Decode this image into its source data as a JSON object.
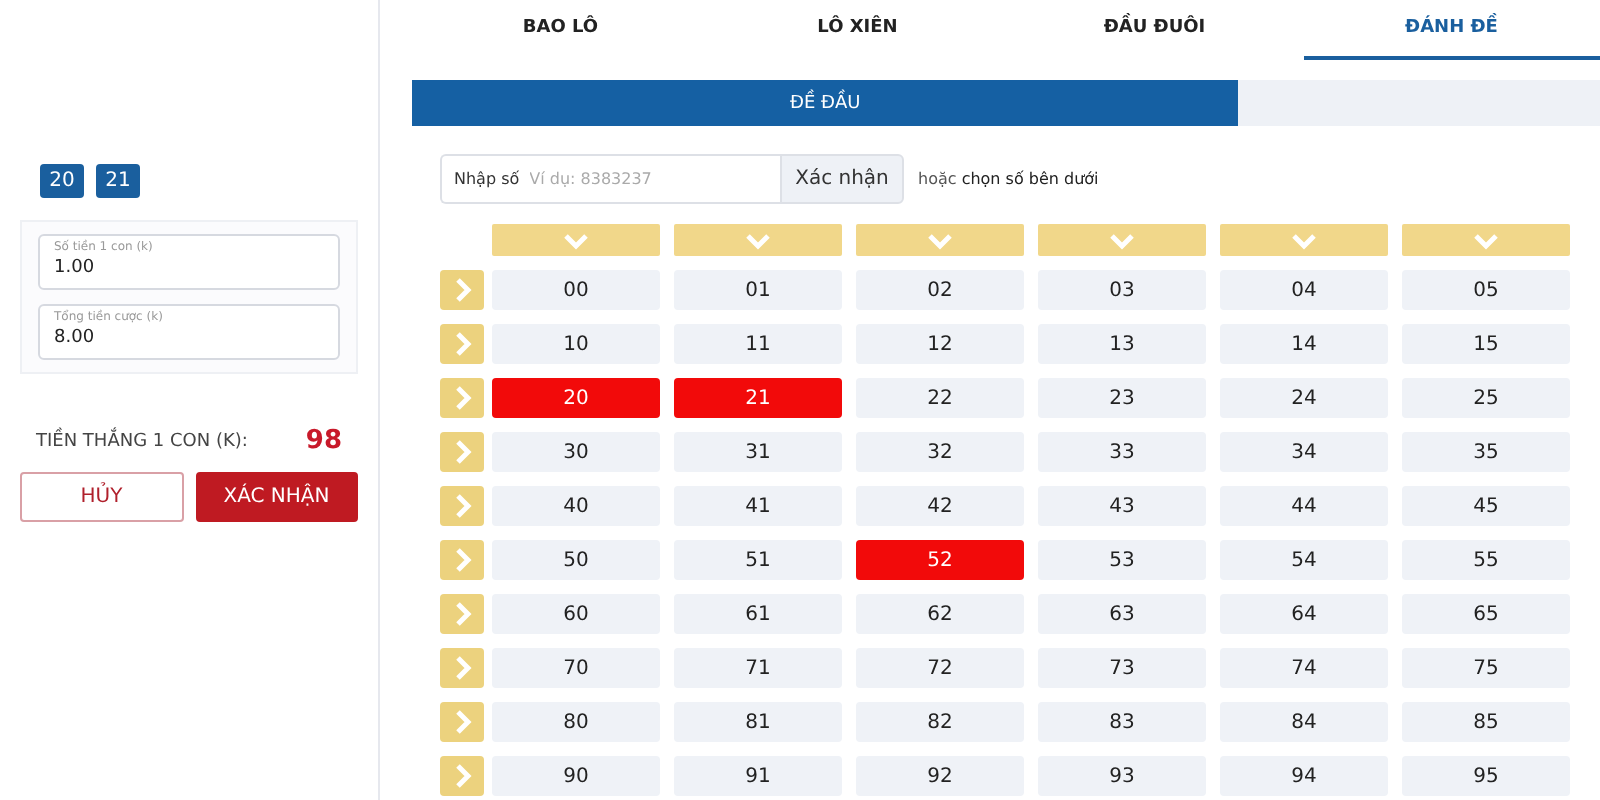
{
  "left_panel": {
    "picked_numbers": [
      "20",
      "21"
    ],
    "fields": [
      {
        "label": "Số tiền 1 con (k)",
        "value": "1.00"
      },
      {
        "label": "Tổng tiền cược (k)",
        "value": "8.00"
      }
    ],
    "win_label": "TIỀN THẮNG 1 CON (K):",
    "win_value": "98",
    "buttons": [
      {
        "label": "HỦY",
        "kind": "secondary"
      },
      {
        "label": "XÁC NHẬN",
        "kind": "primary"
      }
    ]
  },
  "tabs": [
    {
      "label": "BAO LÔ",
      "selected": false
    },
    {
      "label": "LÔ XIÊN",
      "selected": false
    },
    {
      "label": "ĐẦU ĐUÔI",
      "selected": false
    },
    {
      "label": "ĐÁNH ĐỀ",
      "selected": true
    }
  ],
  "sub_tabs": [
    {
      "label": "ĐỀ ĐẦU",
      "selected": true
    },
    {
      "selected": false
    }
  ],
  "entry": {
    "label": "Nhập số",
    "placeholder": "Ví dụ: 8383237",
    "button": "Xác nhận",
    "hint_prefix": "hoặc",
    "hint": "chọn số bên dưới"
  },
  "grid": {
    "rows": [
      {
        "cells": [
          {
            "label": "00",
            "selected": false
          },
          {
            "label": "01",
            "selected": false
          },
          {
            "label": "02",
            "selected": false
          },
          {
            "label": "03",
            "selected": false
          },
          {
            "label": "04",
            "selected": false
          },
          {
            "label": "05",
            "selected": false
          }
        ]
      },
      {
        "cells": [
          {
            "label": "10",
            "selected": false
          },
          {
            "label": "11",
            "selected": false
          },
          {
            "label": "12",
            "selected": false
          },
          {
            "label": "13",
            "selected": false
          },
          {
            "label": "14",
            "selected": false
          },
          {
            "label": "15",
            "selected": false
          }
        ]
      },
      {
        "cells": [
          {
            "label": "20",
            "selected": true
          },
          {
            "label": "21",
            "selected": true
          },
          {
            "label": "22",
            "selected": false
          },
          {
            "label": "23",
            "selected": false
          },
          {
            "label": "24",
            "selected": false
          },
          {
            "label": "25",
            "selected": false
          }
        ]
      },
      {
        "cells": [
          {
            "label": "30",
            "selected": false
          },
          {
            "label": "31",
            "selected": false
          },
          {
            "label": "32",
            "selected": false
          },
          {
            "label": "33",
            "selected": false
          },
          {
            "label": "34",
            "selected": false
          },
          {
            "label": "35",
            "selected": false
          }
        ]
      },
      {
        "cells": [
          {
            "label": "40",
            "selected": false
          },
          {
            "label": "41",
            "selected": false
          },
          {
            "label": "42",
            "selected": false
          },
          {
            "label": "43",
            "selected": false
          },
          {
            "label": "44",
            "selected": false
          },
          {
            "label": "45",
            "selected": false
          }
        ]
      },
      {
        "cells": [
          {
            "label": "50",
            "selected": false
          },
          {
            "label": "51",
            "selected": false
          },
          {
            "label": "52",
            "selected": true
          },
          {
            "label": "53",
            "selected": false
          },
          {
            "label": "54",
            "selected": false
          },
          {
            "label": "55",
            "selected": false
          }
        ]
      },
      {
        "cells": [
          {
            "label": "60",
            "selected": false
          },
          {
            "label": "61",
            "selected": false
          },
          {
            "label": "62",
            "selected": false
          },
          {
            "label": "63",
            "selected": false
          },
          {
            "label": "64",
            "selected": false
          },
          {
            "label": "65",
            "selected": false
          }
        ]
      },
      {
        "cells": [
          {
            "label": "70",
            "selected": false
          },
          {
            "label": "71",
            "selected": false
          },
          {
            "label": "72",
            "selected": false
          },
          {
            "label": "73",
            "selected": false
          },
          {
            "label": "74",
            "selected": false
          },
          {
            "label": "75",
            "selected": false
          }
        ]
      },
      {
        "cells": [
          {
            "label": "80",
            "selected": false
          },
          {
            "label": "81",
            "selected": false
          },
          {
            "label": "82",
            "selected": false
          },
          {
            "label": "83",
            "selected": false
          },
          {
            "label": "84",
            "selected": false
          },
          {
            "label": "85",
            "selected": false
          }
        ]
      },
      {
        "cells": [
          {
            "label": "90",
            "selected": false
          },
          {
            "label": "91",
            "selected": false
          },
          {
            "label": "92",
            "selected": false
          },
          {
            "label": "93",
            "selected": false
          },
          {
            "label": "94",
            "selected": false
          },
          {
            "label": "95",
            "selected": false
          }
        ]
      }
    ]
  }
}
